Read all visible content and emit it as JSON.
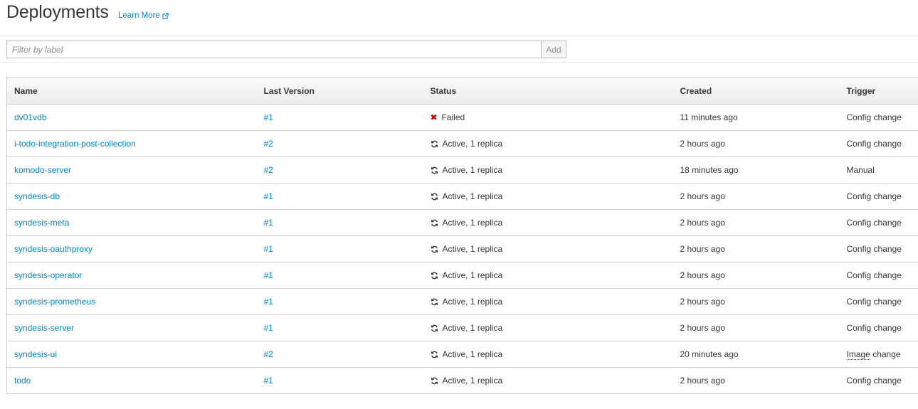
{
  "header": {
    "title": "Deployments",
    "learn_more": "Learn More"
  },
  "filter": {
    "placeholder": "Filter by label",
    "add_label": "Add"
  },
  "table": {
    "columns": {
      "name": "Name",
      "last_version": "Last Version",
      "status": "Status",
      "created": "Created",
      "trigger": "Trigger"
    },
    "rows": [
      {
        "name": "dv01vdb",
        "version": "#1",
        "status": "Failed",
        "status_icon": "failed-x-icon",
        "created": "11 minutes ago",
        "trigger_first": "Config",
        "trigger_rest": " change"
      },
      {
        "name": "i-todo-integration-post-collection",
        "version": "#2",
        "status": "Active, 1 replica",
        "status_icon": "sync-icon",
        "created": "2 hours ago",
        "trigger_first": "Config",
        "trigger_rest": " change"
      },
      {
        "name": "komodo-server",
        "version": "#2",
        "status": "Active, 1 replica",
        "status_icon": "sync-icon",
        "created": "18 minutes ago",
        "trigger_first": "Manual",
        "trigger_rest": ""
      },
      {
        "name": "syndesis-db",
        "version": "#1",
        "status": "Active, 1 replica",
        "status_icon": "sync-icon",
        "created": "2 hours ago",
        "trigger_first": "Config",
        "trigger_rest": " change"
      },
      {
        "name": "syndesis-meta",
        "version": "#1",
        "status": "Active, 1 replica",
        "status_icon": "sync-icon",
        "created": "2 hours ago",
        "trigger_first": "Config",
        "trigger_rest": " change"
      },
      {
        "name": "syndesis-oauthproxy",
        "version": "#1",
        "status": "Active, 1 replica",
        "status_icon": "sync-icon",
        "created": "2 hours ago",
        "trigger_first": "Config",
        "trigger_rest": " change"
      },
      {
        "name": "syndesis-operator",
        "version": "#1",
        "status": "Active, 1 replica",
        "status_icon": "sync-icon",
        "created": "2 hours ago",
        "trigger_first": "Config",
        "trigger_rest": " change"
      },
      {
        "name": "syndesis-prometheus",
        "version": "#1",
        "status": "Active, 1 replica",
        "status_icon": "sync-icon",
        "created": "2 hours ago",
        "trigger_first": "Config",
        "trigger_rest": " change"
      },
      {
        "name": "syndesis-server",
        "version": "#1",
        "status": "Active, 1 replica",
        "status_icon": "sync-icon",
        "created": "2 hours ago",
        "trigger_first": "Config",
        "trigger_rest": " change"
      },
      {
        "name": "syndesis-ui",
        "version": "#2",
        "status": "Active, 1 replica",
        "status_icon": "sync-icon",
        "created": "20 minutes ago",
        "trigger_first": "Image",
        "trigger_rest": " change",
        "trigger_dotted": true
      },
      {
        "name": "todo",
        "version": "#1",
        "status": "Active, 1 replica",
        "status_icon": "sync-icon",
        "created": "2 hours ago",
        "trigger_first": "Config",
        "trigger_rest": " change"
      }
    ]
  },
  "colors": {
    "link": "#0088ce",
    "failed": "#cc0000",
    "text": "#363636"
  }
}
